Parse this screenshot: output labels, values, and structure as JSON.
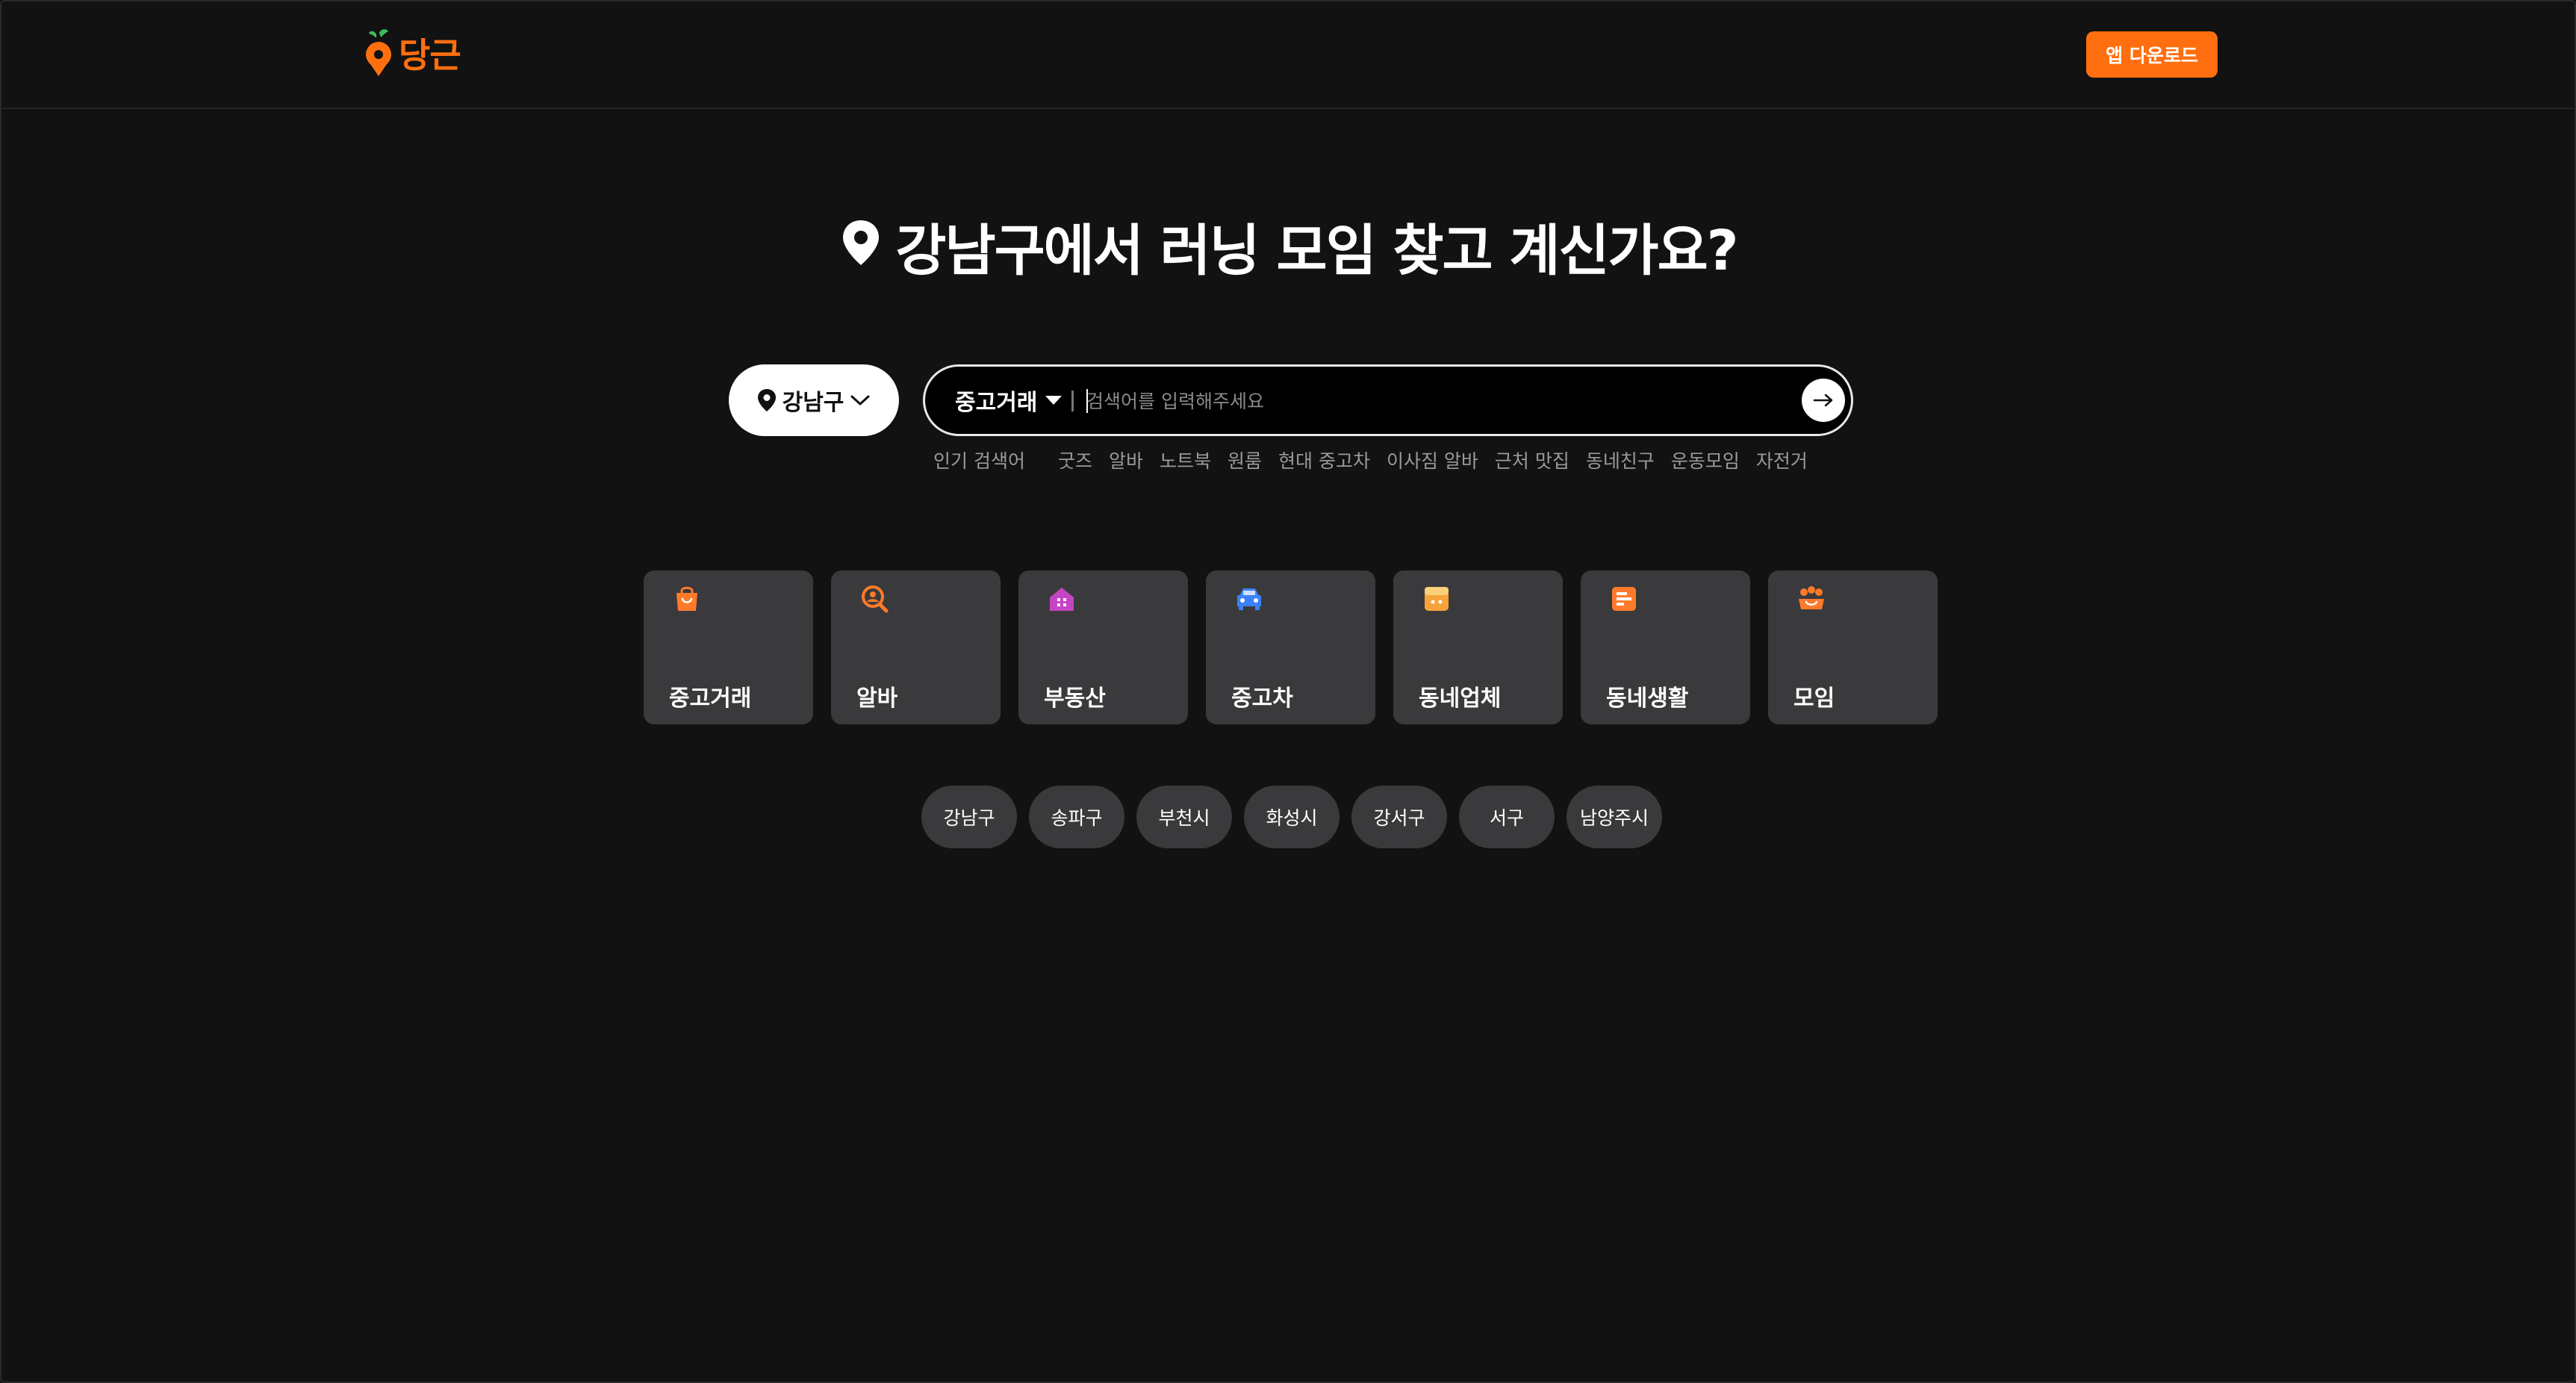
{
  "header": {
    "logo_text": "당근",
    "app_download_label": "앱 다운로드"
  },
  "hero": {
    "title": "강남구에서 러닝 모임 찾고 계신가요?"
  },
  "search": {
    "location_label": "강남구",
    "category_label": "중고거래",
    "placeholder": "검색어를 입력해주세요",
    "popular_label": "인기 검색어",
    "popular_keywords": [
      "굿즈",
      "알바",
      "노트북",
      "원룸",
      "현대 중고차",
      "이사짐 알바",
      "근처 맛집",
      "동네친구",
      "운동모임",
      "자전거"
    ]
  },
  "categories": [
    {
      "label": "중고거래",
      "icon": "shopping-bag-icon",
      "color": "#ff7a2a"
    },
    {
      "label": "알바",
      "icon": "job-search-icon",
      "color": "#ff7a2a"
    },
    {
      "label": "부동산",
      "icon": "house-icon",
      "color": "#c445c4"
    },
    {
      "label": "중고차",
      "icon": "car-icon",
      "color": "#3b82f6"
    },
    {
      "label": "동네업체",
      "icon": "store-icon",
      "color": "#f5a33a"
    },
    {
      "label": "동네생활",
      "icon": "note-icon",
      "color": "#ff7a2a"
    },
    {
      "label": "모임",
      "icon": "group-icon",
      "color": "#ff7a2a"
    }
  ],
  "regions": [
    "강남구",
    "송파구",
    "부천시",
    "화성시",
    "강서구",
    "서구",
    "남양주시"
  ],
  "colors": {
    "brand": "#ff6f0f",
    "background": "#121212",
    "card": "#3a3a3c"
  }
}
